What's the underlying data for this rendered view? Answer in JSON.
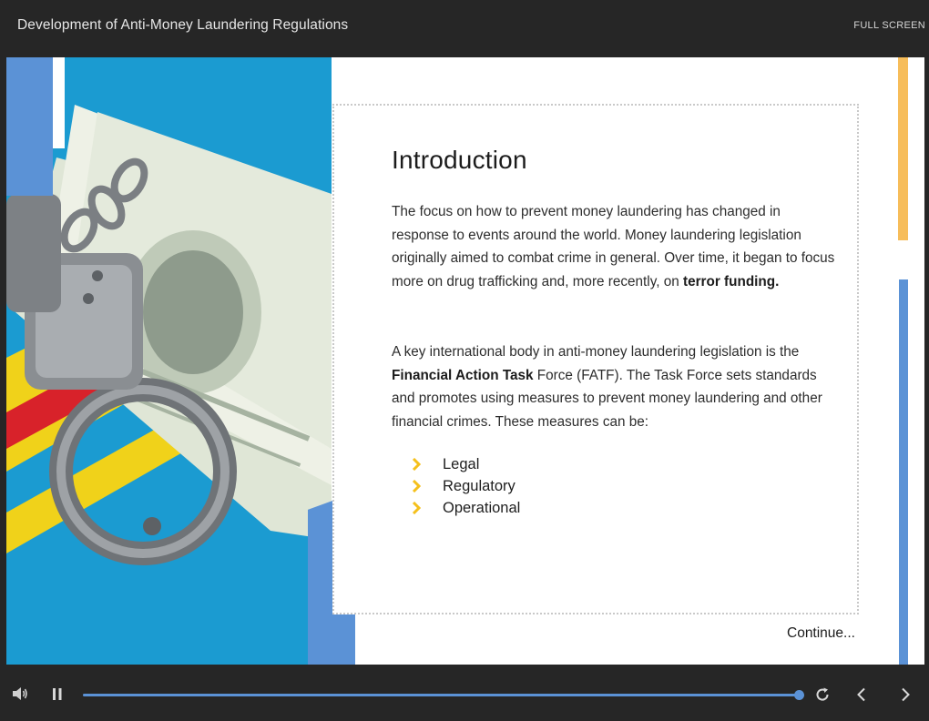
{
  "header": {
    "course_title": "Development of Anti-Money Laundering Regulations",
    "fullscreen_label": "FULL SCREEN"
  },
  "slide": {
    "heading": "Introduction",
    "paragraph1": {
      "text": "The focus on how to prevent money laundering has changed in response to events around the world. Money laundering legislation originally aimed to combat crime in general. Over time, it began to focus more on drug trafficking and, more recently, on ",
      "bold": "terror funding."
    },
    "paragraph2": {
      "before": "A key international body in anti-money laundering legislation is the ",
      "bold": "Financial Action Task",
      "after": " Force (FATF). The Task Force sets standards and promotes using measures to prevent money laundering and other financial crimes. These measures can be:"
    },
    "measures": [
      "Legal",
      "Regulatory",
      "Operational"
    ],
    "continue_label": "Continue...",
    "image": {
      "description_icons": [
        "handcuffs-icon",
        "dollar-bills-icon"
      ]
    }
  },
  "player": {
    "progress": 1.0,
    "icons": {
      "volume": "volume-icon",
      "pause": "pause-icon",
      "replay": "replay-icon",
      "prev": "chevron-left-icon",
      "next": "chevron-right-icon"
    }
  },
  "colors": {
    "accent_blue": "#5b92d6",
    "accent_orange": "#f7b552",
    "bullet_yellow": "#f5c01c",
    "chrome_bg": "#262626"
  }
}
